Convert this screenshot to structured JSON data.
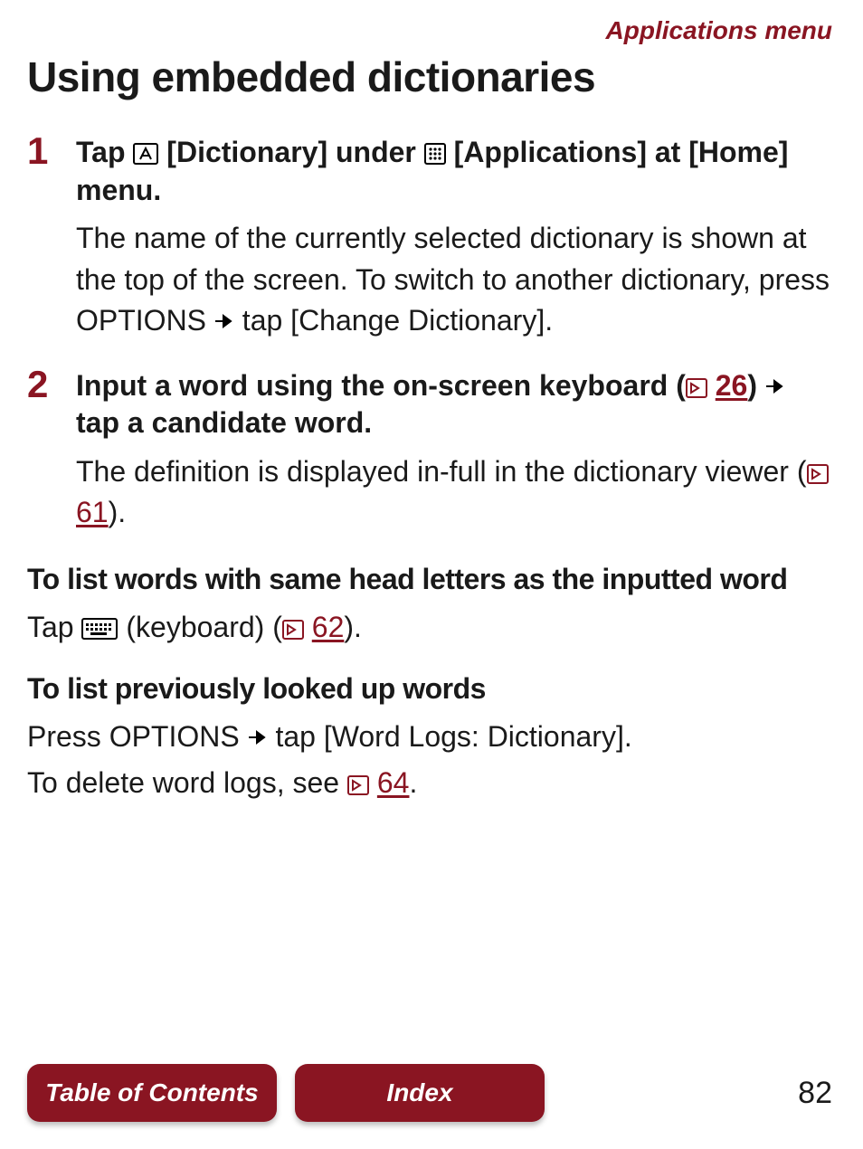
{
  "breadcrumb": "Applications menu",
  "title": "Using embedded dictionaries",
  "steps": [
    {
      "num": "1",
      "head_a": "Tap ",
      "head_b": " [Dictionary] under ",
      "head_c": " [Applications] at [Home] menu.",
      "body_a": "The name of the currently selected dictionary is shown at the top of the screen. To switch to another dictionary, press OPTIONS ",
      "body_b": " tap [Change Dictionary]."
    },
    {
      "num": "2",
      "head_a": "Input a word using the on-screen keyboard (",
      "page_ref": "26",
      "head_b": ") ",
      "head_c": " tap a candidate word.",
      "body_a": "The definition is displayed in-full in the dictionary viewer (",
      "page_ref2": "61",
      "body_b": ")."
    }
  ],
  "sub1": {
    "head": "To list words with same head letters as the inputted word",
    "body_a": "Tap ",
    "body_b": " (keyboard) (",
    "page_ref": "62",
    "body_c": ")."
  },
  "sub2": {
    "head": "To list previously looked up words",
    "line1_a": "Press OPTIONS ",
    "line1_b": " tap [Word Logs: Dictionary].",
    "line2_a": "To delete word logs, see ",
    "page_ref": "64",
    "line2_b": "."
  },
  "footer": {
    "toc": "Table of Contents",
    "index": "Index",
    "page": "82"
  }
}
